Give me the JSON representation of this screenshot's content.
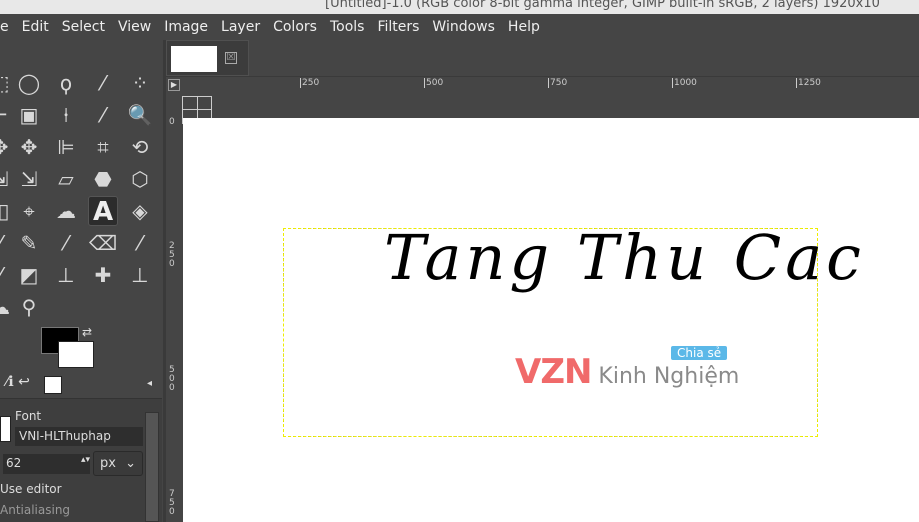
{
  "window": {
    "title": "[Untitled]-1.0 (RGB color 8-bit gamma integer, GIMP built-in sRGB, 2 layers) 1920x10"
  },
  "menu": [
    "e",
    "Edit",
    "Select",
    "View",
    "Image",
    "Layer",
    "Colors",
    "Tools",
    "Filters",
    "Windows",
    "Help"
  ],
  "tools": [
    {
      "name": "rect-select-icon",
      "glyph": "⬚"
    },
    {
      "name": "ellipse-select-icon",
      "glyph": "◯"
    },
    {
      "name": "lasso-icon",
      "glyph": "ϙ"
    },
    {
      "name": "fuzzy-select-icon",
      "glyph": "⁄"
    },
    {
      "name": "select-by-color-icon",
      "glyph": "⁘"
    },
    {
      "name": "crop-icon",
      "glyph": "⌐"
    },
    {
      "name": "foreground-select-icon",
      "glyph": "▣"
    },
    {
      "name": "paths-icon",
      "glyph": "⍿"
    },
    {
      "name": "color-picker-icon",
      "glyph": "⁄"
    },
    {
      "name": "zoom-icon",
      "glyph": "🔍"
    },
    {
      "name": "move-icon",
      "glyph": "✥"
    },
    {
      "name": "move-icon",
      "glyph": "✥"
    },
    {
      "name": "align-icon",
      "glyph": "⊫"
    },
    {
      "name": "crop-tool-icon",
      "glyph": "⌗"
    },
    {
      "name": "rotate-icon",
      "glyph": "⟲"
    },
    {
      "name": "scale-icon",
      "glyph": "⇲"
    },
    {
      "name": "scale-icon",
      "glyph": "⇲"
    },
    {
      "name": "shear-icon",
      "glyph": "▱"
    },
    {
      "name": "cage-icon",
      "glyph": "⬣"
    },
    {
      "name": "3d-transform-icon",
      "glyph": "⬡"
    },
    {
      "name": "unified-transform-icon",
      "glyph": "◫"
    },
    {
      "name": "handle-transform-icon",
      "glyph": "⌖"
    },
    {
      "name": "warp-icon",
      "glyph": "☁"
    },
    {
      "name": "text-icon",
      "glyph": "A"
    },
    {
      "name": "bucket-fill-icon",
      "glyph": "◈"
    },
    {
      "name": "paintbrush-icon",
      "glyph": "⁄"
    },
    {
      "name": "pencil-icon",
      "glyph": "✎"
    },
    {
      "name": "brush-icon",
      "glyph": "⁄"
    },
    {
      "name": "eraser-icon",
      "glyph": "⌫"
    },
    {
      "name": "airbrush-icon",
      "glyph": "⁄"
    },
    {
      "name": "ink-icon",
      "glyph": "⁄"
    },
    {
      "name": "mypaint-icon",
      "glyph": "◩"
    },
    {
      "name": "clone-icon",
      "glyph": "⊥"
    },
    {
      "name": "heal-icon",
      "glyph": "✚"
    },
    {
      "name": "perspective-clone-icon",
      "glyph": "⊥"
    },
    {
      "name": "smudge-icon",
      "glyph": "☁"
    },
    {
      "name": "dodge-burn-icon",
      "glyph": "⚲"
    }
  ],
  "options": {
    "font_label": "Font",
    "font_value": "VNI-HLThuphap",
    "size_value": "62",
    "unit": "px",
    "use_editor": "Use editor",
    "antialiasing": "Antialiasing"
  },
  "tab": {
    "close": "☒"
  },
  "ruler": {
    "h": [
      "250",
      "500",
      "750",
      "1000",
      "1250"
    ],
    "v": [
      "0",
      "250",
      "500",
      "750"
    ]
  },
  "canvas": {
    "text": "Tang Thu Cac"
  },
  "watermark": {
    "brand": "VZN",
    "text": "Kinh Nghiệm",
    "badge": "Chia sẻ",
    "brand_color": "#f06a6a"
  }
}
